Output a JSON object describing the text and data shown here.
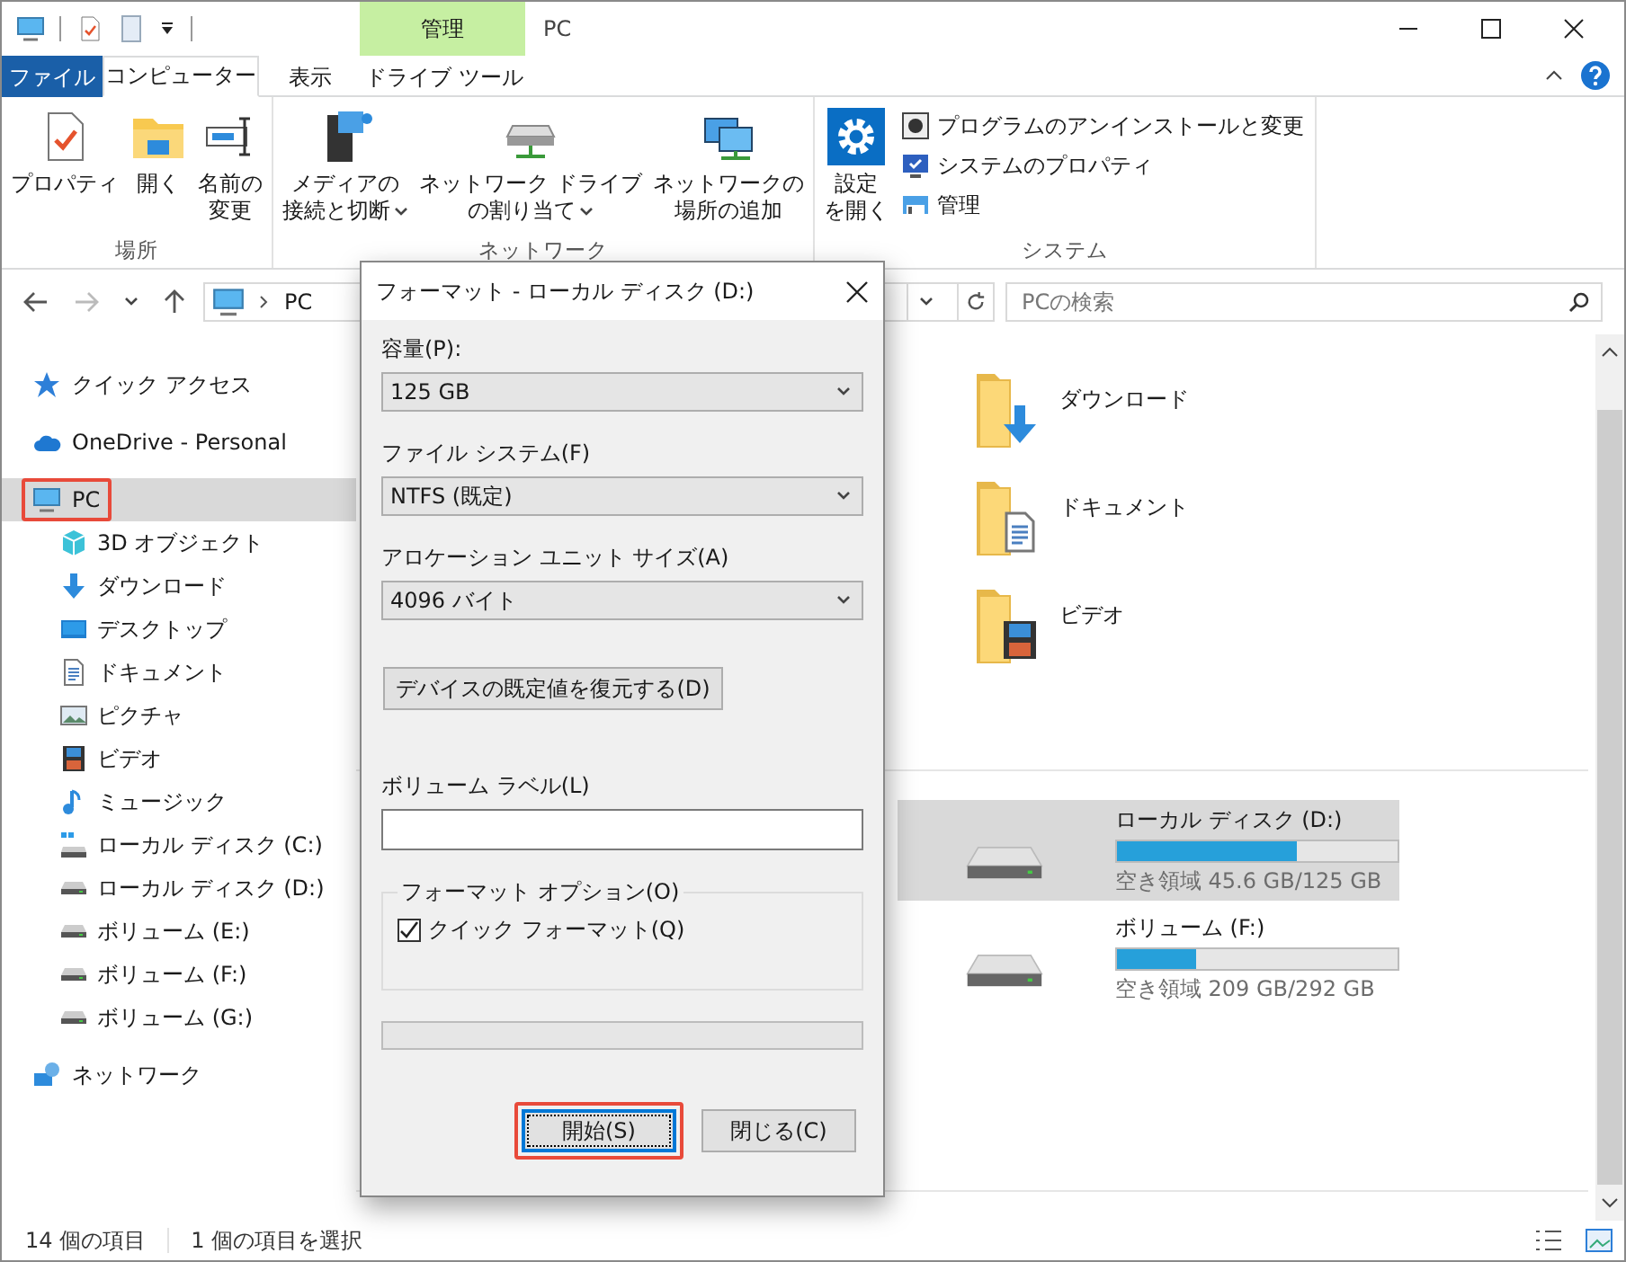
{
  "window": {
    "title": "PC",
    "context_header": "管理"
  },
  "ribbon_tabs": [
    {
      "label": "ファイル",
      "kind": "file",
      "selected": false
    },
    {
      "label": "コンピューター",
      "kind": "tab",
      "selected": true
    },
    {
      "label": "表示",
      "kind": "tab",
      "selected": false
    },
    {
      "label": "ドライブ ツール",
      "kind": "context",
      "selected": false
    }
  ],
  "ribbon_groups": [
    {
      "label": "場所",
      "commands": [
        {
          "kind": "large",
          "lines": [
            "プロパティ"
          ],
          "has_menu": false
        },
        {
          "kind": "large",
          "lines": [
            "開く"
          ],
          "has_menu": false
        },
        {
          "kind": "large",
          "lines": [
            "名前の",
            "変更"
          ],
          "has_menu": false
        }
      ]
    },
    {
      "label": "ネットワーク",
      "commands": [
        {
          "kind": "large",
          "lines": [
            "メディアの",
            "接続と切断"
          ],
          "has_menu": true
        },
        {
          "kind": "large",
          "lines": [
            "ネットワーク ドライブ",
            "の割り当て"
          ],
          "has_menu": true
        },
        {
          "kind": "large",
          "lines": [
            "ネットワークの",
            "場所の追加"
          ],
          "has_menu": false
        }
      ]
    },
    {
      "label": "システム",
      "commands": [
        {
          "kind": "large",
          "lines": [
            "設定",
            "を開く"
          ],
          "has_menu": false
        },
        {
          "kind": "small",
          "lines": [
            "プログラムのアンインストールと変更"
          ]
        },
        {
          "kind": "small",
          "lines": [
            "システムのプロパティ"
          ]
        },
        {
          "kind": "small",
          "lines": [
            "管理"
          ]
        }
      ]
    }
  ],
  "address_bar": {
    "path": "PC"
  },
  "search": {
    "placeholder": "PCの検索"
  },
  "navigation": [
    {
      "label": "クイック アクセス",
      "selected": false,
      "highlighted": false
    },
    {
      "label": "OneDrive - Personal",
      "selected": false,
      "highlighted": false
    },
    {
      "label": "PC",
      "selected": true,
      "highlighted": true,
      "children": [
        {
          "label": "3D オブジェクト",
          "selected": false
        },
        {
          "label": "ダウンロード",
          "selected": false
        },
        {
          "label": "デスクトップ",
          "selected": false
        },
        {
          "label": "ドキュメント",
          "selected": false
        },
        {
          "label": "ピクチャ",
          "selected": false
        },
        {
          "label": "ビデオ",
          "selected": false
        },
        {
          "label": "ミュージック",
          "selected": false
        },
        {
          "label": "ローカル ディスク (C:)",
          "selected": false
        },
        {
          "label": "ローカル ディスク (D:)",
          "selected": false
        },
        {
          "label": "ボリューム (E:)",
          "selected": false
        },
        {
          "label": "ボリューム (F:)",
          "selected": false
        },
        {
          "label": "ボリューム (G:)",
          "selected": false
        }
      ]
    },
    {
      "label": "ネットワーク",
      "selected": false,
      "highlighted": false
    }
  ],
  "folders": [
    {
      "label": "ダウンロード"
    },
    {
      "label": "ドキュメント"
    },
    {
      "label": "ビデオ"
    }
  ],
  "drives": [
    {
      "label": "ローカル ディスク (D:)",
      "level": 0.64,
      "free_space": "空き領域 45.6 GB/125 GB",
      "selected": true
    },
    {
      "label": "ボリューム (F:)",
      "level": 0.28,
      "free_space": "空き領域 209 GB/292 GB",
      "selected": false
    }
  ],
  "dialog": {
    "title": "フォーマット - ローカル ディスク (D:)",
    "fields": [
      {
        "label": "容量(P):",
        "value": "125 GB"
      },
      {
        "label": "ファイル システム(F)",
        "value": "NTFS (既定)"
      },
      {
        "label": "アロケーション ユニット サイズ(A)",
        "value": "4096 バイト"
      }
    ],
    "restore_button": "デバイスの既定値を復元する(D)",
    "volume_label": {
      "label": "ボリューム ラベル(L)"
    },
    "options": {
      "legend": "フォーマット オプション(O)",
      "items": [
        {
          "label": "クイック フォーマット(Q)",
          "checked": true
        }
      ]
    },
    "progress": {
      "level": 0
    },
    "buttons": [
      {
        "label": "開始(S)",
        "default": true,
        "highlighted": true
      },
      {
        "label": "閉じる(C)",
        "default": false,
        "highlighted": false
      }
    ]
  },
  "status_bar": {
    "item_count": "14 個の項目",
    "selection": "1 個の項目を選択"
  }
}
